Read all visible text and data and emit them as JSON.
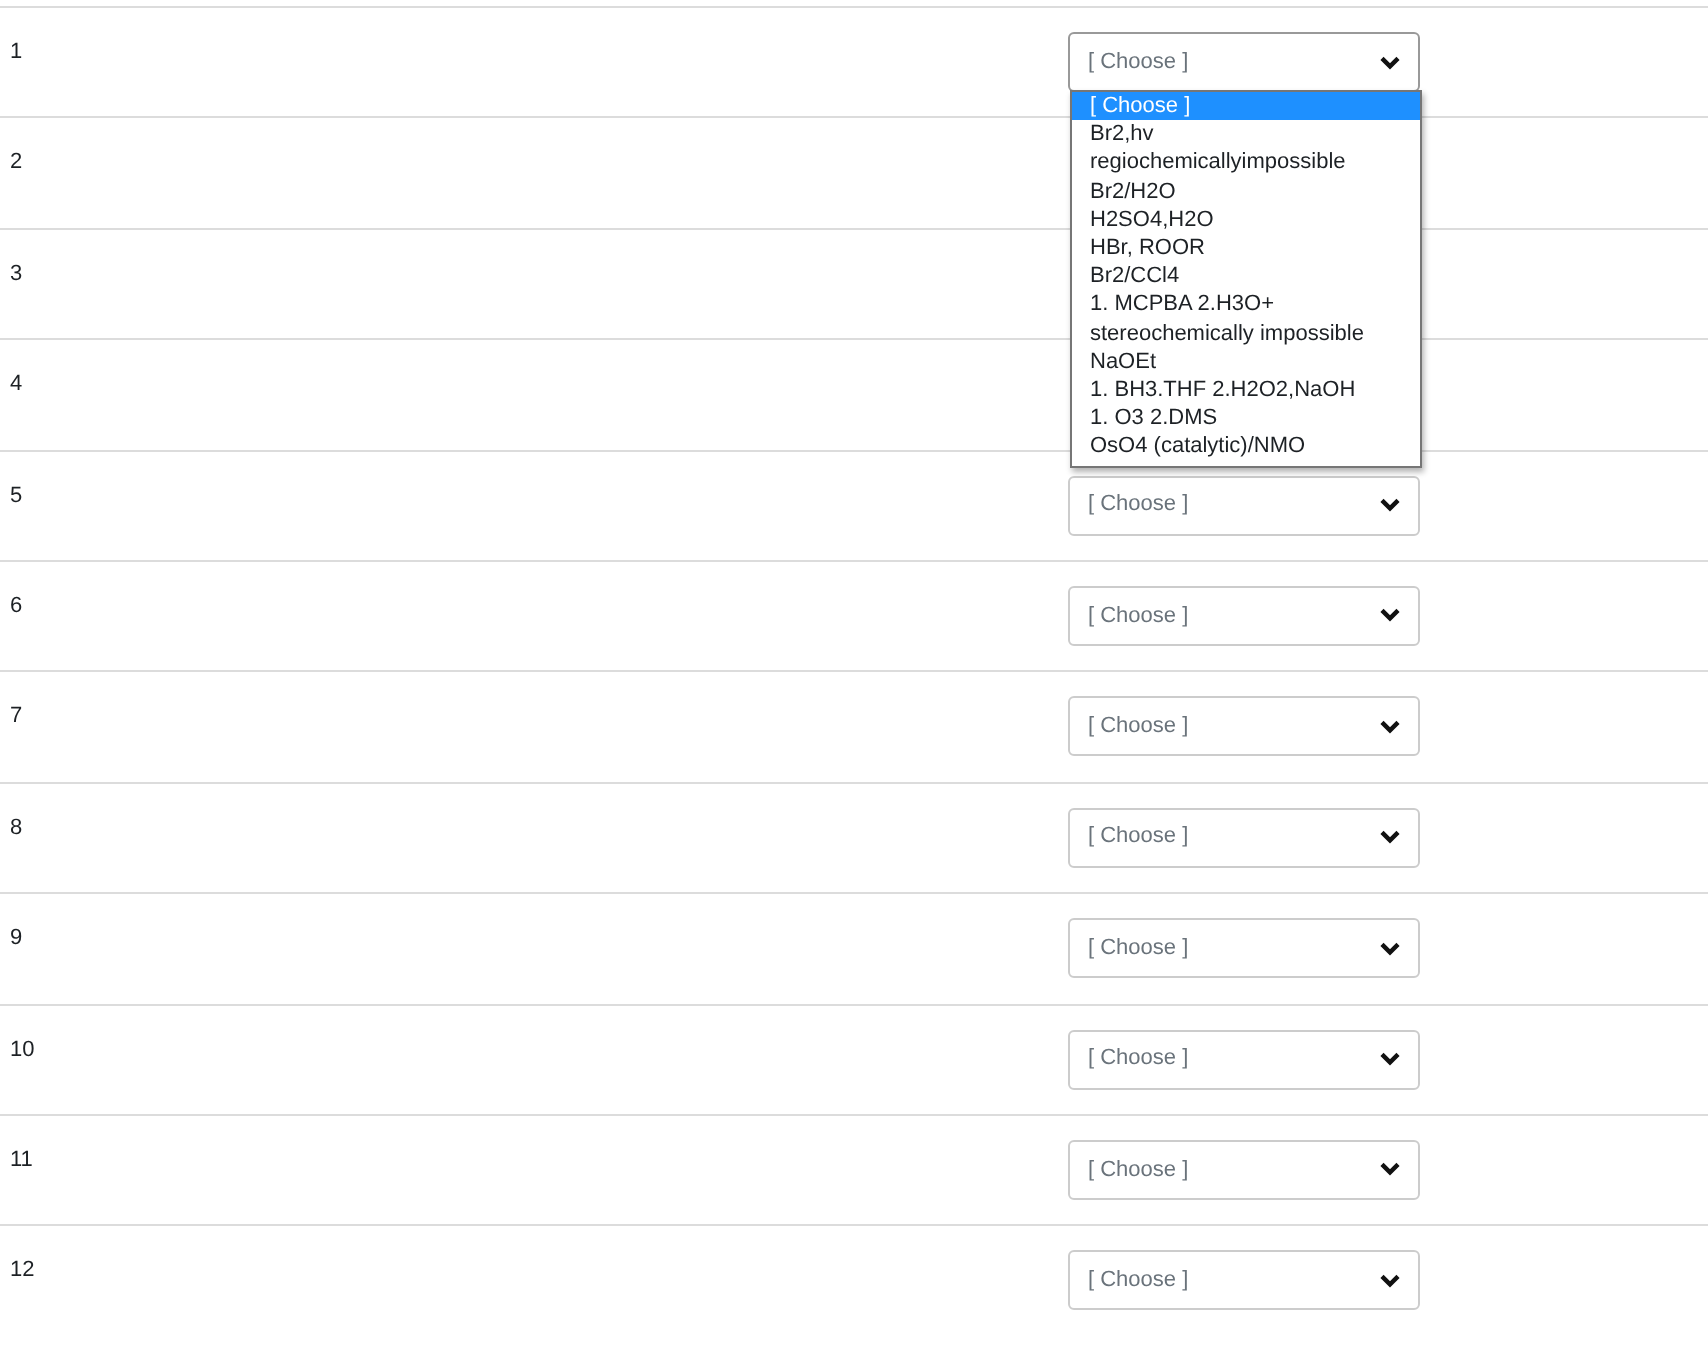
{
  "rows": [
    {
      "label": "1",
      "select": {
        "value": "[ Choose ]",
        "expanded": true,
        "options": [
          {
            "label": "[ Choose ]",
            "selected": true
          },
          {
            "label": "Br2,hv",
            "selected": false
          },
          {
            "label": "regiochemicallyimpossible",
            "selected": false
          },
          {
            "label": "Br2/H2O",
            "selected": false
          },
          {
            "label": "H2SO4,H2O",
            "selected": false
          },
          {
            "label": "HBr, ROOR",
            "selected": false
          },
          {
            "label": "Br2/CCl4",
            "selected": false
          },
          {
            "label": "1. MCPBA 2.H3O+",
            "selected": false
          },
          {
            "label": "stereochemically impossible",
            "selected": false
          },
          {
            "label": "NaOEt",
            "selected": false
          },
          {
            "label": "1. BH3.THF 2.H2O2,NaOH",
            "selected": false
          },
          {
            "label": "1. O3 2.DMS",
            "selected": false
          },
          {
            "label": "OsO4 (catalytic)/NMO",
            "selected": false
          }
        ]
      }
    },
    {
      "label": "2"
    },
    {
      "label": "3"
    },
    {
      "label": "4"
    },
    {
      "label": "5",
      "select": {
        "value": "[ Choose ]",
        "expanded": false
      }
    },
    {
      "label": "6",
      "select": {
        "value": "[ Choose ]",
        "expanded": false
      }
    },
    {
      "label": "7",
      "select": {
        "value": "[ Choose ]",
        "expanded": false
      }
    },
    {
      "label": "8",
      "select": {
        "value": "[ Choose ]",
        "expanded": false
      }
    },
    {
      "label": "9",
      "select": {
        "value": "[ Choose ]",
        "expanded": false
      }
    },
    {
      "label": "10",
      "select": {
        "value": "[ Choose ]",
        "expanded": false
      }
    },
    {
      "label": "11",
      "select": {
        "value": "[ Choose ]",
        "expanded": false
      }
    },
    {
      "label": "12",
      "select": {
        "value": "[ Choose ]",
        "expanded": false
      }
    }
  ]
}
